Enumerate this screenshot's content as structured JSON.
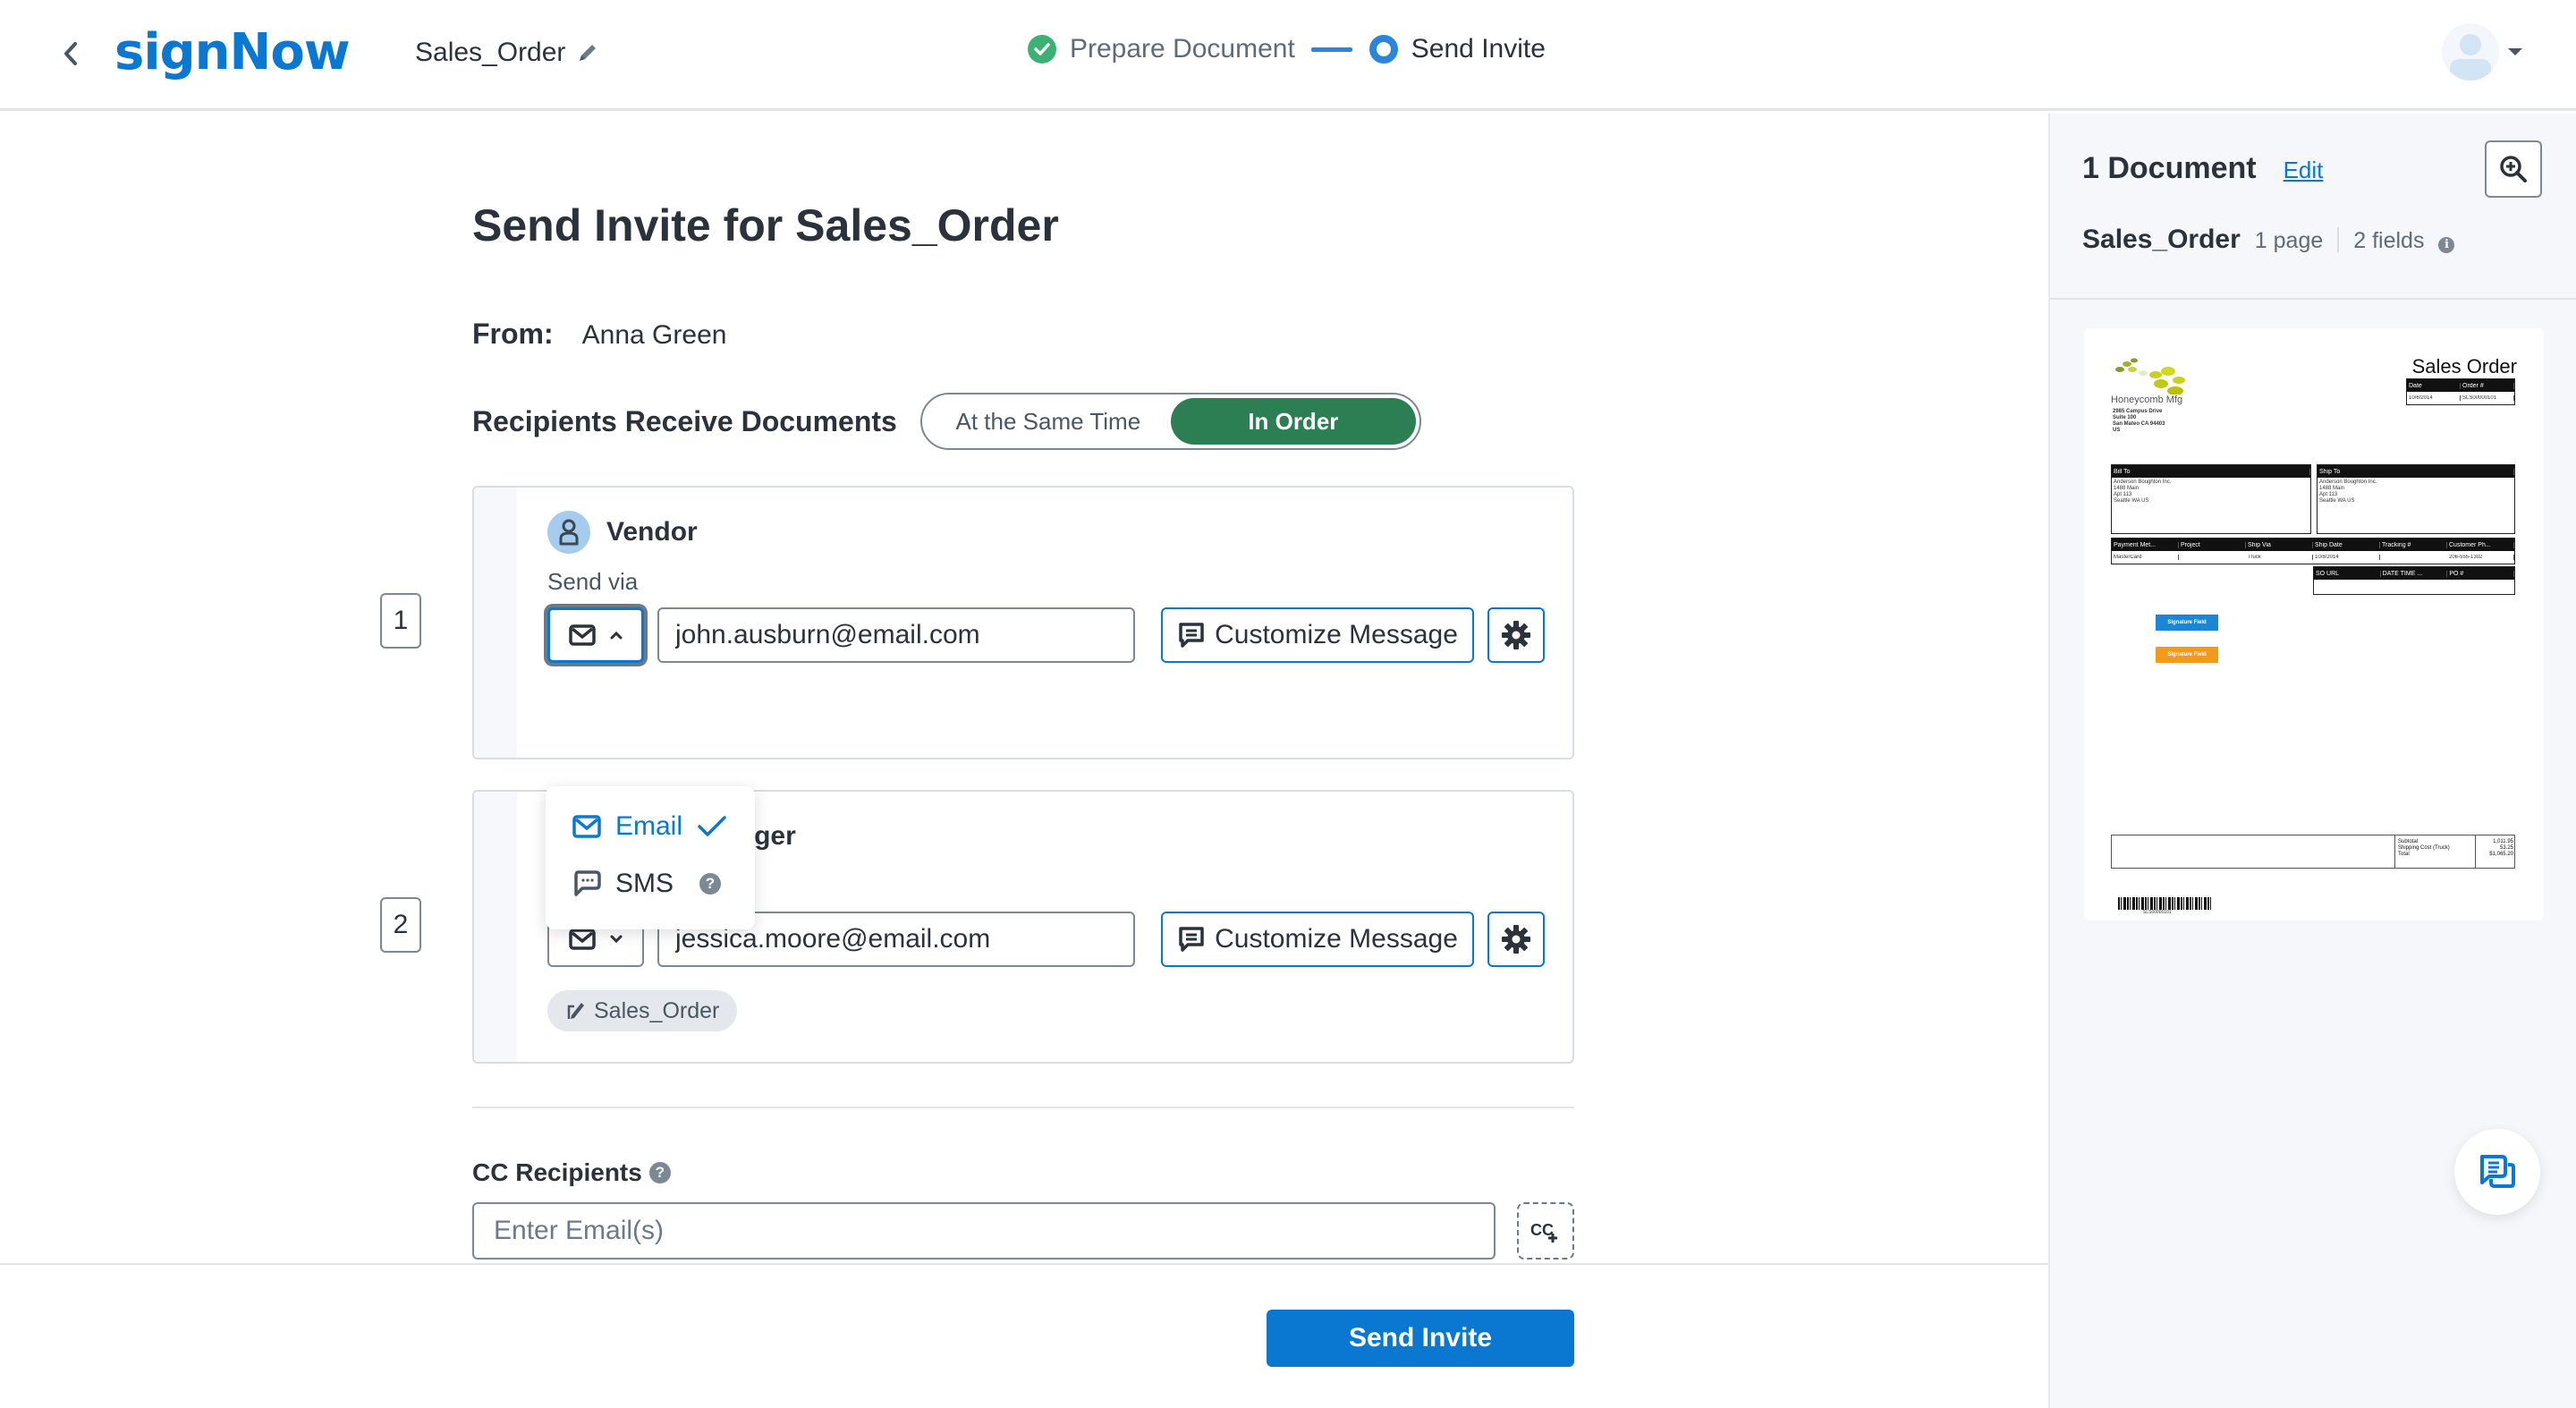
{
  "header": {
    "logo": "signNow",
    "document_name": "Sales_Order",
    "steps": [
      {
        "label": "Prepare Document",
        "status": "done"
      },
      {
        "label": "Send Invite",
        "status": "current"
      }
    ],
    "icons": {
      "back": "chevron-left-icon",
      "edit": "pencil-icon",
      "avatar": "user-avatar-icon",
      "menu": "caret-down-icon"
    }
  },
  "main": {
    "title": "Send Invite for Sales_Order",
    "from_label": "From:",
    "from_value": "Anna Green",
    "order_label": "Recipients Receive Documents",
    "order_options": [
      {
        "label": "At the Same Time",
        "active": false
      },
      {
        "label": "In Order",
        "active": true
      }
    ],
    "send_via_label": "Send via",
    "customize_label": "Customize Message",
    "recipients": [
      {
        "order": "1",
        "role": "Vendor",
        "avatar_color": "#a5cbee",
        "method": "email",
        "email": "john.ausburn@email.com",
        "dropdown_open": true,
        "documents": []
      },
      {
        "order": "2",
        "role": "Sales manager",
        "avatar_color": "#f7c97e",
        "method": "email",
        "email": "jessica.moore@email.com",
        "dropdown_open": false,
        "documents": [
          "Sales_Order"
        ]
      }
    ],
    "method_dropdown": {
      "options": [
        {
          "label": "Email",
          "icon": "envelope-icon",
          "selected": true
        },
        {
          "label": "SMS",
          "icon": "chat-bubble-icon",
          "selected": false,
          "help": true
        }
      ]
    },
    "cc": {
      "label": "CC Recipients",
      "placeholder": "Enter Email(s)",
      "value": "",
      "add_button_label": "CC+"
    },
    "send_button": "Send Invite"
  },
  "sidebar": {
    "doc_count": "1 Document",
    "edit_link": "Edit",
    "doc_name": "Sales_Order",
    "pages": "1 page",
    "fields": "2 fields",
    "thumbnail": {
      "title": "Sales Order",
      "company": "Honeycomb Mfg",
      "company_address": [
        "2985 Campus Drive",
        "Suite 100",
        "San Mateo CA 94403",
        "US"
      ],
      "date_header": [
        "Date",
        "Order #"
      ],
      "date_values": [
        "10/6/2014",
        "SLS00000101"
      ],
      "bill_to_header": "Bill To",
      "ship_to_header": "Ship To",
      "address": [
        "Anderson Boughton Inc.",
        "1488 Main",
        "Apt 113",
        "Seattle WA US"
      ],
      "info_header": [
        "Payment Met...",
        "Project",
        "Ship Via",
        "Ship Date",
        "Tracking #",
        "Customer Ph..."
      ],
      "info_values": [
        "MasterCard",
        "",
        "Truck",
        "10/8/2014",
        "",
        "206-555-1302"
      ],
      "info2_header": [
        "SO URL",
        "DATE TIME ...",
        "PO #"
      ],
      "signature_fields": [
        {
          "label": "Signature Field",
          "color": "#1a87d6"
        },
        {
          "label": "Signature Field",
          "color": "#f29b1a"
        }
      ],
      "totals_labels": [
        "Subtotal",
        "Shipping Cost (Truck)",
        "Total"
      ],
      "totals_values": [
        "1,011.95",
        "53.25",
        "$1,065.20"
      ],
      "barcode_text": "SLS00000101"
    }
  },
  "colors": {
    "brand": "#0a77d0",
    "toggle_active": "#2b7f52",
    "step_done": "#3bb273",
    "text": "#2b323b"
  }
}
